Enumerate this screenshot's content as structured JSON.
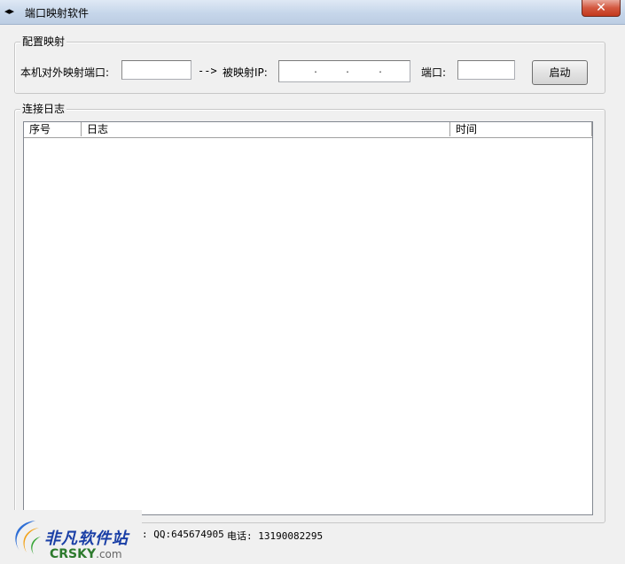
{
  "window": {
    "title": "端口映射软件",
    "close_glyph": "✕",
    "icon_glyph": "◂▸"
  },
  "config": {
    "legend": "配置映射",
    "local_port_label": "本机对外映射端口:",
    "local_port_value": "",
    "arrow_text": "-->",
    "mapped_ip_label": "被映射IP:",
    "ip_dot": ".",
    "port_label": "端口:",
    "port_value": "",
    "start_button": "启动"
  },
  "log": {
    "legend": "连接日志",
    "columns": [
      "序号",
      "日志",
      "时间"
    ],
    "rows": []
  },
  "footer": {
    "qq": ": QQ:645674905",
    "phone": "电话: 13190082295"
  },
  "watermark": {
    "cn": "非凡软件站",
    "en": "CRSKY",
    "en_suffix": ".com"
  }
}
